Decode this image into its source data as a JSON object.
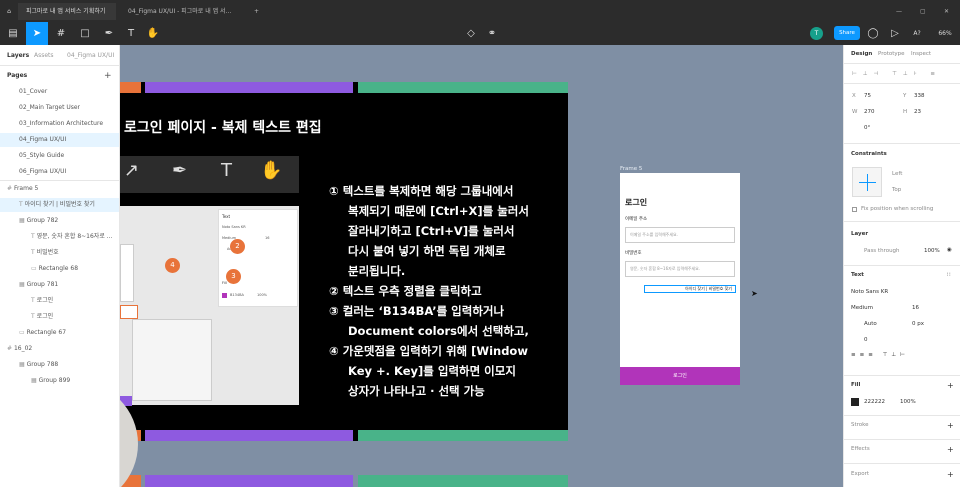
{
  "tabs": {
    "home": "⌂",
    "tab1": "피그마로 내 앱 서비스 기획하기",
    "tab2": "04_Figma UX/UI - 피그마로 내 앱 서...",
    "add": "+"
  },
  "window": {
    "min": "—",
    "max": "▢",
    "close": "✕"
  },
  "toolbar": {
    "zoom": "66%",
    "share": "Share",
    "avatar": "T"
  },
  "left": {
    "tab_layers": "Layers",
    "tab_assets": "Assets",
    "file": "04_Figma UX/UI",
    "pages_title": "Pages",
    "pages": [
      "01_Cover",
      "02_Main Target User",
      "03_Information Architecture",
      "04_Figma UX/UI",
      "05_Style Guide",
      "06_Figma UX/UI"
    ],
    "layers": [
      "Frame 5",
      "아이디 찾기 | 비밀번호 찾기",
      "Group 782",
      "영문, 숫자 혼합 8~16자로 ...",
      "비밀번호",
      "Rectangle 68",
      "Group 781",
      "로그인",
      "로그인",
      "Rectangle 67",
      "16_02",
      "Group 788",
      "Group 899"
    ]
  },
  "slide": {
    "title": "로그인 페이지 - 복제 텍스트 편집",
    "lines": [
      "① 텍스트를 복제하면 해당 그룹내에서",
      "복제되기 때문에 [Ctrl+X]를 눌러서",
      "잘라내기하고 [Ctrl+V]를 눌러서",
      "다시 붙여 넣기 하면 독립 개체로",
      "분리됩니다.",
      "② 텍스트 우측 정렬을 클릭하고",
      "③ 컬러는 ‘B134BA’를 입력하거나",
      "Document colors에서 선택하고,",
      "④ 가운뎃점을 입력하기 위해 [Window",
      "Key +. Key]를 입력하면 이모지",
      "상자가 나타나고 · 선택 가능"
    ],
    "badges": [
      "2",
      "3",
      "4"
    ],
    "mini": {
      "text": "Text",
      "font": "Noto Sans KR",
      "weight": "Medium",
      "size": "16",
      "auto": "Auto",
      "fill": "Fill",
      "color": "B134BA",
      "pct": "100%"
    }
  },
  "frame": {
    "label": "Frame 5",
    "title": "로그인",
    "email_label": "이메일 주소",
    "email_ph": "이메일 주소를 입력해주세요.",
    "pw_label": "비밀번호",
    "pw_ph": "영문, 숫자 혼합 8~16자로 입력해주세요.",
    "find": "아이디 찾기 | 비밀번호 찾기",
    "button": "로그인"
  },
  "right": {
    "tab_design": "Design",
    "tab_proto": "Prototype",
    "tab_inspect": "Inspect",
    "x": "X",
    "xv": "75",
    "y": "Y",
    "yv": "338",
    "w": "W",
    "wv": "270",
    "h": "H",
    "hv": "23",
    "rot": "0°",
    "constraints": "Constraints",
    "c_left": "Left",
    "c_top": "Top",
    "fix": "Fix position when scrolling",
    "layer": "Layer",
    "pass": "Pass through",
    "layer_pct": "100%",
    "text": "Text",
    "font": "Noto Sans KR",
    "weight": "Medium",
    "size": "16",
    "auto": "Auto",
    "ls": "0 px",
    "lh": "0",
    "fill": "Fill",
    "hex": "222222",
    "fill_pct": "100%",
    "stroke": "Stroke",
    "effects": "Effects",
    "export": "Export"
  }
}
